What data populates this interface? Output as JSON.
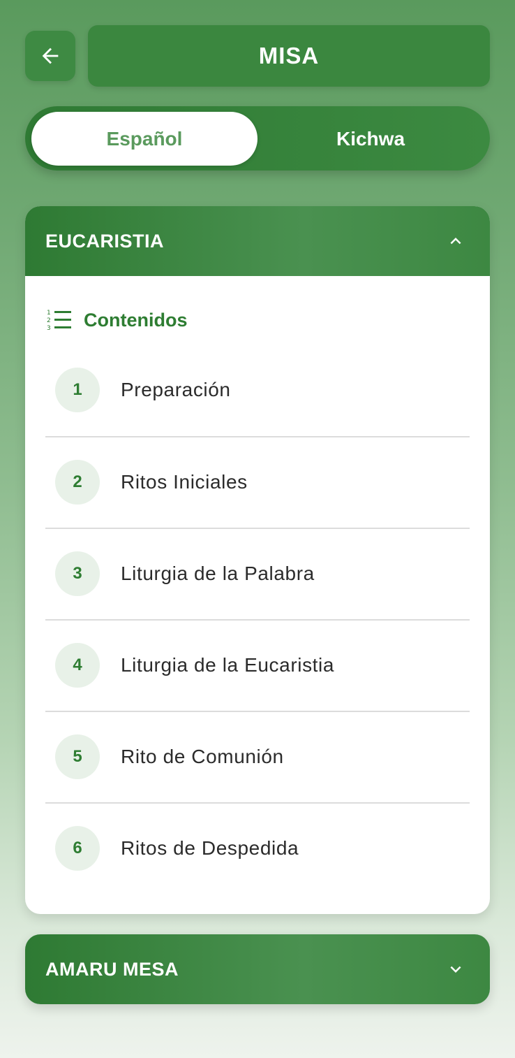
{
  "header": {
    "back_icon": "arrow-left-icon",
    "title": "MISA"
  },
  "language_toggle": {
    "options": [
      "Español",
      "Kichwa"
    ],
    "selected": "Español"
  },
  "sections": [
    {
      "title": "EUCARISTIA",
      "expanded": true,
      "chevron_icon": "chevron-up-icon",
      "contents_label": "Contenidos",
      "contents_icon": "numbered-list-icon",
      "items": [
        {
          "number": "1",
          "label": "Preparación"
        },
        {
          "number": "2",
          "label": "Ritos Iniciales"
        },
        {
          "number": "3",
          "label": "Liturgia de la Palabra"
        },
        {
          "number": "4",
          "label": "Liturgia de la Eucaristia"
        },
        {
          "number": "5",
          "label": "Rito de Comunión"
        },
        {
          "number": "6",
          "label": "Ritos de Despedida"
        }
      ]
    },
    {
      "title": "AMARU MESA",
      "expanded": false,
      "chevron_icon": "chevron-down-icon"
    }
  ],
  "colors": {
    "primary": "#3b873f",
    "accent_text": "#2e7d32",
    "number_badge_bg": "#e8f1e8"
  }
}
